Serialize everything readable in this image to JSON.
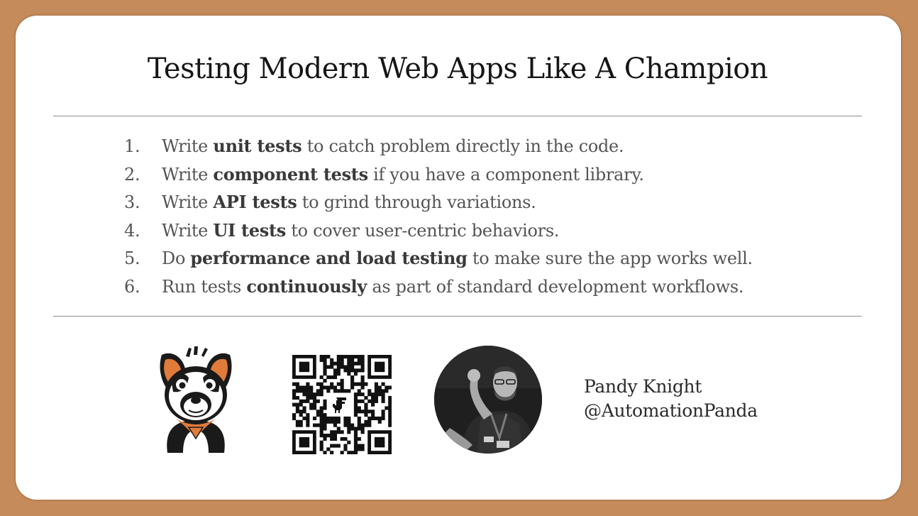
{
  "slide": {
    "title": "Testing Modern Web Apps Like A Champion",
    "items": [
      {
        "num": "1.",
        "pre": "Write ",
        "bold": "unit tests",
        "post": " to catch problem directly in the code."
      },
      {
        "num": "2.",
        "pre": "Write ",
        "bold": "component tests",
        "post": " if you have a component library."
      },
      {
        "num": "3.",
        "pre": "Write ",
        "bold": "API tests",
        "post": " to grind through variations."
      },
      {
        "num": "4.",
        "pre": "Write ",
        "bold": "UI tests",
        "post": " to cover user-centric behaviors."
      },
      {
        "num": "5.",
        "pre": "Do ",
        "bold": "performance and load testing",
        "post": " to make sure the app works well."
      },
      {
        "num": "6.",
        "pre": "Run tests ",
        "bold": "continuously",
        "post": " as part of standard development workflows."
      }
    ],
    "author": {
      "name": "Pandy Knight",
      "handle": "@AutomationPanda"
    },
    "icons": [
      "panda-dog-mascot-icon",
      "qr-code-icon",
      "speaker-photo"
    ],
    "colors": {
      "frame": "#c68b5a",
      "card": "#ffffff",
      "accent": "#e07b3a"
    }
  }
}
